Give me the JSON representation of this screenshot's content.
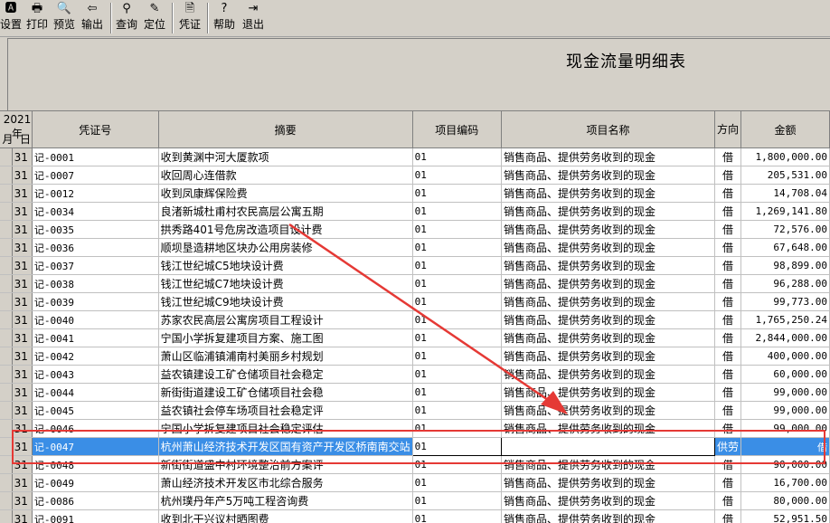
{
  "toolbar": {
    "items": [
      {
        "label": "设置",
        "icon": "settings-icon",
        "glyph": "🅰"
      },
      {
        "label": "打印",
        "icon": "printer-icon",
        "glyph": "🖶"
      },
      {
        "label": "预览",
        "icon": "preview-icon",
        "glyph": "🔍"
      },
      {
        "label": "输出",
        "icon": "export-icon",
        "glyph": "⇦"
      },
      {
        "label": "查询",
        "icon": "binoculars-icon",
        "glyph": "⚲"
      },
      {
        "label": "定位",
        "icon": "locate-icon",
        "glyph": "✎"
      },
      {
        "label": "凭证",
        "icon": "voucher-icon",
        "glyph": "🗎"
      },
      {
        "label": "帮助",
        "icon": "help-icon",
        "glyph": "?"
      },
      {
        "label": "退出",
        "icon": "exit-icon",
        "glyph": "⇥"
      }
    ]
  },
  "report": {
    "title": "现金流量明细表"
  },
  "columns": {
    "year": "2021年",
    "month": "月",
    "day": "日",
    "voucher": "凭证号",
    "summary": "摘要",
    "item_code": "项目编码",
    "item_name": "项目名称",
    "direction": "方向",
    "amount": "金额"
  },
  "rows": [
    {
      "day": "31",
      "voucher": "记-0001",
      "summary": "收到黄渊中河大厦款项",
      "code": "01",
      "name": "销售商品、提供劳务收到的现金",
      "dir": "借",
      "amount": "1,800,000.00"
    },
    {
      "day": "31",
      "voucher": "记-0007",
      "summary": "收回周心连借款",
      "code": "01",
      "name": "销售商品、提供劳务收到的现金",
      "dir": "借",
      "amount": "205,531.00"
    },
    {
      "day": "31",
      "voucher": "记-0012",
      "summary": "收到凤康辉保险费",
      "code": "01",
      "name": "销售商品、提供劳务收到的现金",
      "dir": "借",
      "amount": "14,708.04"
    },
    {
      "day": "31",
      "voucher": "记-0034",
      "summary": "良渚新城杜甫村农民高层公寓五期",
      "code": "01",
      "name": "销售商品、提供劳务收到的现金",
      "dir": "借",
      "amount": "1,269,141.80"
    },
    {
      "day": "31",
      "voucher": "记-0035",
      "summary": "拱秀路401号危房改造项目设计费",
      "code": "01",
      "name": "销售商品、提供劳务收到的现金",
      "dir": "借",
      "amount": "72,576.00"
    },
    {
      "day": "31",
      "voucher": "记-0036",
      "summary": "顺坝垦造耕地区块办公用房装修",
      "code": "01",
      "name": "销售商品、提供劳务收到的现金",
      "dir": "借",
      "amount": "67,648.00"
    },
    {
      "day": "31",
      "voucher": "记-0037",
      "summary": "钱江世纪城C5地块设计费",
      "code": "01",
      "name": "销售商品、提供劳务收到的现金",
      "dir": "借",
      "amount": "98,899.00"
    },
    {
      "day": "31",
      "voucher": "记-0038",
      "summary": "钱江世纪城C7地块设计费",
      "code": "01",
      "name": "销售商品、提供劳务收到的现金",
      "dir": "借",
      "amount": "96,288.00"
    },
    {
      "day": "31",
      "voucher": "记-0039",
      "summary": "钱江世纪城C9地块设计费",
      "code": "01",
      "name": "销售商品、提供劳务收到的现金",
      "dir": "借",
      "amount": "99,773.00"
    },
    {
      "day": "31",
      "voucher": "记-0040",
      "summary": "苏家农民高层公寓房项目工程设计",
      "code": "01",
      "name": "销售商品、提供劳务收到的现金",
      "dir": "借",
      "amount": "1,765,250.24"
    },
    {
      "day": "31",
      "voucher": "记-0041",
      "summary": "宁国小学拆复建项目方案、施工图",
      "code": "01",
      "name": "销售商品、提供劳务收到的现金",
      "dir": "借",
      "amount": "2,844,000.00"
    },
    {
      "day": "31",
      "voucher": "记-0042",
      "summary": "萧山区临浦镇浦南村美丽乡村规划",
      "code": "01",
      "name": "销售商品、提供劳务收到的现金",
      "dir": "借",
      "amount": "400,000.00"
    },
    {
      "day": "31",
      "voucher": "记-0043",
      "summary": "益农镇建设工矿仓储项目社会稳定",
      "code": "01",
      "name": "销售商品、提供劳务收到的现金",
      "dir": "借",
      "amount": "60,000.00"
    },
    {
      "day": "31",
      "voucher": "记-0044",
      "summary": "新街街道建设工矿仓储项目社会稳",
      "code": "01",
      "name": "销售商品、提供劳务收到的现金",
      "dir": "借",
      "amount": "99,000.00"
    },
    {
      "day": "31",
      "voucher": "记-0045",
      "summary": "益农镇社会停车场项目社会稳定评",
      "code": "01",
      "name": "销售商品、提供劳务收到的现金",
      "dir": "借",
      "amount": "99,000.00"
    },
    {
      "day": "31",
      "voucher": "记-0046",
      "summary": "宁国小学拆复建项目社会稳定评估",
      "code": "01",
      "name": "销售商品、提供劳务收到的现金",
      "dir": "借",
      "amount": "99,000.00"
    },
    {
      "day": "31",
      "voucher": "记-0047",
      "summary": "杭州萧山经济技术开发区国有资产开发区桥南南交站",
      "code": "01",
      "name": "",
      "dir": "供劳",
      "amount": "借",
      "selected": true
    },
    {
      "day": "31",
      "voucher": "记-0048",
      "summary": "新街街道盛中村环境整治前方案评",
      "code": "01",
      "name": "销售商品、提供劳务收到的现金",
      "dir": "借",
      "amount": "90,000.00"
    },
    {
      "day": "31",
      "voucher": "记-0049",
      "summary": "萧山经济技术开发区市北综合服务",
      "code": "01",
      "name": "销售商品、提供劳务收到的现金",
      "dir": "借",
      "amount": "16,700.00"
    },
    {
      "day": "31",
      "voucher": "记-0086",
      "summary": "杭州璞丹年产5万吨工程咨询费",
      "code": "01",
      "name": "销售商品、提供劳务收到的现金",
      "dir": "借",
      "amount": "80,000.00"
    },
    {
      "day": "31",
      "voucher": "记-0091",
      "summary": "收到北干兴议村晒图费",
      "code": "01",
      "name": "销售商品、提供劳务收到的现金",
      "dir": "借",
      "amount": "52,951.50"
    }
  ]
}
